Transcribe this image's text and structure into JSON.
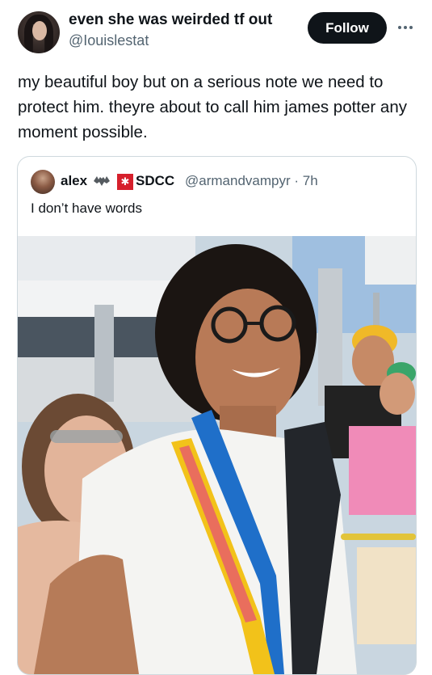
{
  "post": {
    "author_name": "even she was weirded tf out",
    "author_handle": "@Iouislestat",
    "follow_label": "Follow",
    "more_icon": "more-horizontal-icon",
    "text": "my beautiful boy but on a serious note we need to protect him. theyre about to call him james potter any moment possible."
  },
  "quote": {
    "author_name": "alex",
    "bat_icon": "bat-emoji-icon",
    "badge_icon": "sdcc-badge-icon",
    "author_name_suffix": "SDCC",
    "handle_time": "@armandvampyr · 7h",
    "text": "I don’t have words",
    "photo_label": "photo of a smiling man with curly hair and glasses at a convention, with fans behind him"
  },
  "colors": {
    "text_primary": "#0f1419",
    "text_secondary": "#536471",
    "follow_bg": "#0f1419",
    "border": "#cfd9de",
    "badge_red": "#d6202c"
  }
}
